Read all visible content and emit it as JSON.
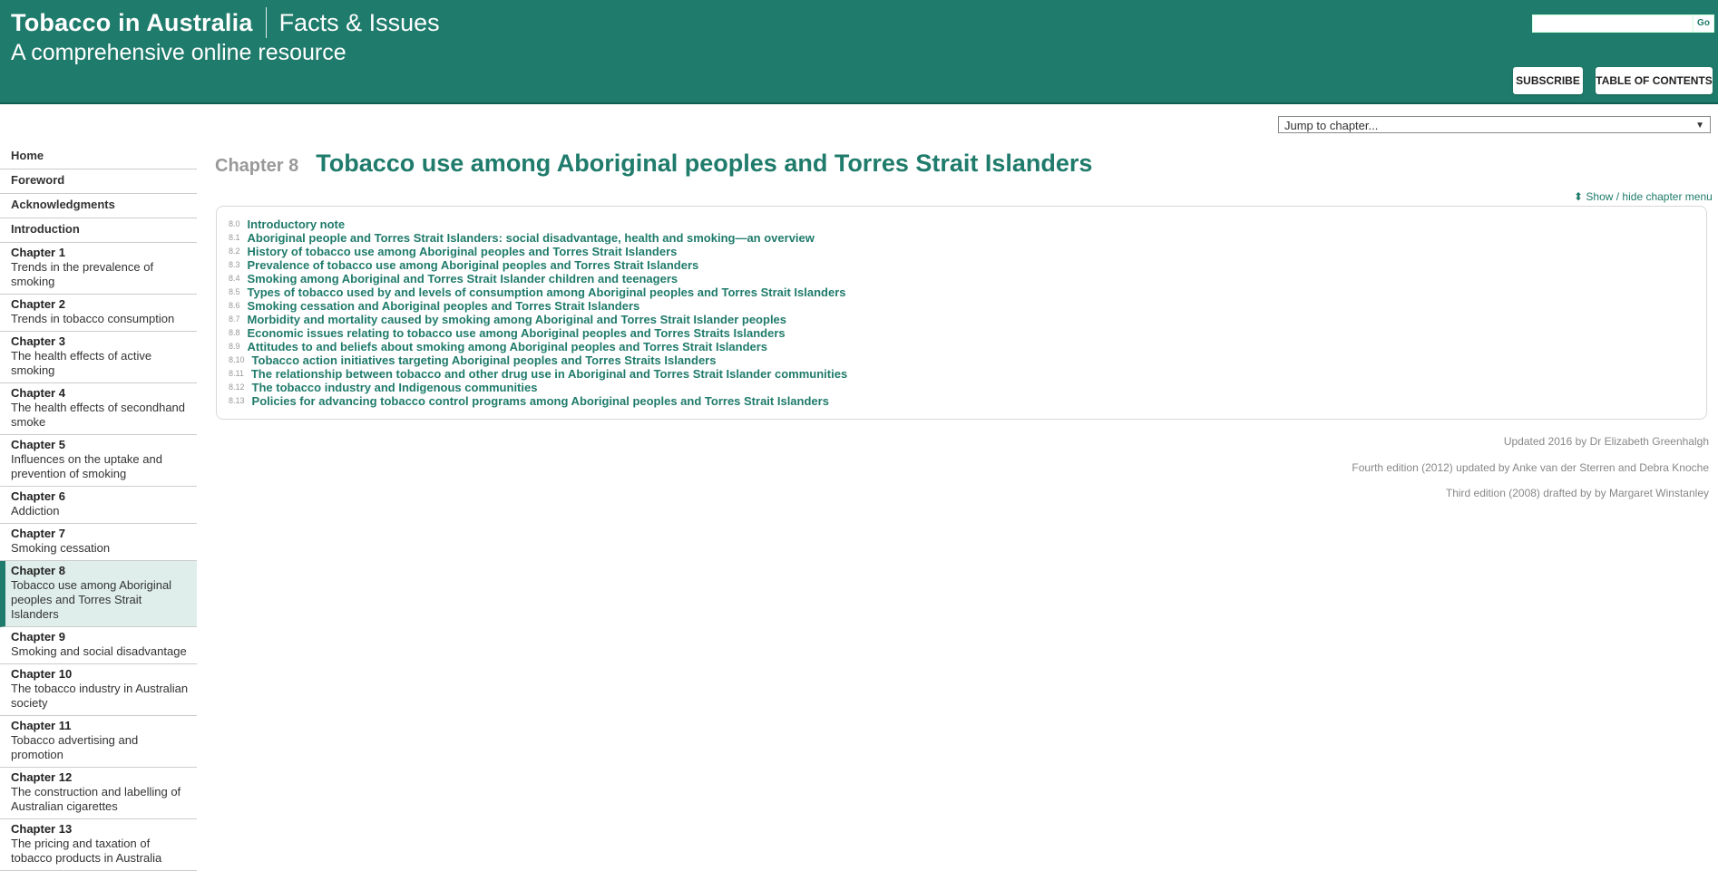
{
  "header": {
    "title": "Tobacco in Australia",
    "subtitle": "Facts & Issues",
    "tagline": "A comprehensive online resource",
    "search_value": "",
    "go_label": "Go",
    "subscribe_label": "SUBSCRIBE",
    "toc_label": "TABLE OF CONTENTS"
  },
  "jump": {
    "label": "Jump to chapter..."
  },
  "sidebar": {
    "simple": [
      {
        "label": "Home"
      },
      {
        "label": "Foreword"
      },
      {
        "label": "Acknowledgments"
      },
      {
        "label": "Introduction"
      }
    ],
    "chapters": [
      {
        "title": "Chapter 1",
        "desc": "Trends in the prevalence of smoking"
      },
      {
        "title": "Chapter 2",
        "desc": "Trends in tobacco consumption"
      },
      {
        "title": "Chapter 3",
        "desc": "The health effects of active smoking"
      },
      {
        "title": "Chapter 4",
        "desc": "The health effects of secondhand smoke"
      },
      {
        "title": "Chapter 5",
        "desc": "Influences on the uptake and prevention of smoking"
      },
      {
        "title": "Chapter 6",
        "desc": "Addiction"
      },
      {
        "title": "Chapter 7",
        "desc": "Smoking cessation"
      },
      {
        "title": "Chapter 8",
        "desc": "Tobacco use among Aboriginal peoples and Torres Strait Islanders"
      },
      {
        "title": "Chapter 9",
        "desc": "Smoking and social disadvantage"
      },
      {
        "title": "Chapter 10",
        "desc": "The tobacco industry in Australian society"
      },
      {
        "title": "Chapter 11",
        "desc": "Tobacco advertising and promotion"
      },
      {
        "title": "Chapter 12",
        "desc": "The construction and labelling of Australian cigarettes"
      },
      {
        "title": "Chapter 13",
        "desc": "The pricing and taxation of tobacco products in Australia"
      }
    ]
  },
  "chapter": {
    "number": "Chapter 8",
    "title": "Tobacco use among Aboriginal peoples and Torres Strait Islanders"
  },
  "toggle_label": "Show / hide chapter menu",
  "menu": [
    {
      "n": "8.0",
      "l": "Introductory note"
    },
    {
      "n": "8.1",
      "l": "Aboriginal people and Torres Strait Islanders: social disadvantage, health and smoking—an overview"
    },
    {
      "n": "8.2",
      "l": "History of tobacco use among Aboriginal peoples and Torres Strait Islanders"
    },
    {
      "n": "8.3",
      "l": "Prevalence of tobacco use among Aboriginal peoples and Torres Strait Islanders"
    },
    {
      "n": "8.4",
      "l": "Smoking among Aboriginal and Torres Strait Islander children and teenagers"
    },
    {
      "n": "8.5",
      "l": "Types of tobacco used by and levels of consumption among Aboriginal peoples and Torres Strait Islanders"
    },
    {
      "n": "8.6",
      "l": "Smoking cessation and Aboriginal peoples and Torres Strait Islanders"
    },
    {
      "n": "8.7",
      "l": "Morbidity and mortality caused by smoking among Aboriginal and Torres Strait Islander peoples"
    },
    {
      "n": "8.8",
      "l": "Economic issues relating to tobacco use among Aboriginal peoples and Torres Straits Islanders"
    },
    {
      "n": "8.9",
      "l": "Attitudes to and beliefs about smoking among Aboriginal peoples and Torres Strait Islanders"
    },
    {
      "n": "8.10",
      "l": "Tobacco action initiatives targeting Aboriginal peoples and Torres Straits Islanders"
    },
    {
      "n": "8.11",
      "l": "The relationship between tobacco and other drug use in Aboriginal and Torres Strait Islander communities"
    },
    {
      "n": "8.12",
      "l": "The tobacco industry and Indigenous communities"
    },
    {
      "n": "8.13",
      "l": "Policies for advancing tobacco control programs among Aboriginal peoples and Torres Strait Islanders"
    }
  ],
  "credits": [
    "Updated 2016 by Dr Elizabeth Greenhalgh",
    "Fourth edition (2012) updated by Anke van der Sterren and Debra Knoche",
    "Third edition (2008) drafted by by Margaret Winstanley"
  ],
  "colors": {
    "brand": "#1f7b6b",
    "active_bg": "#dfeeea"
  }
}
